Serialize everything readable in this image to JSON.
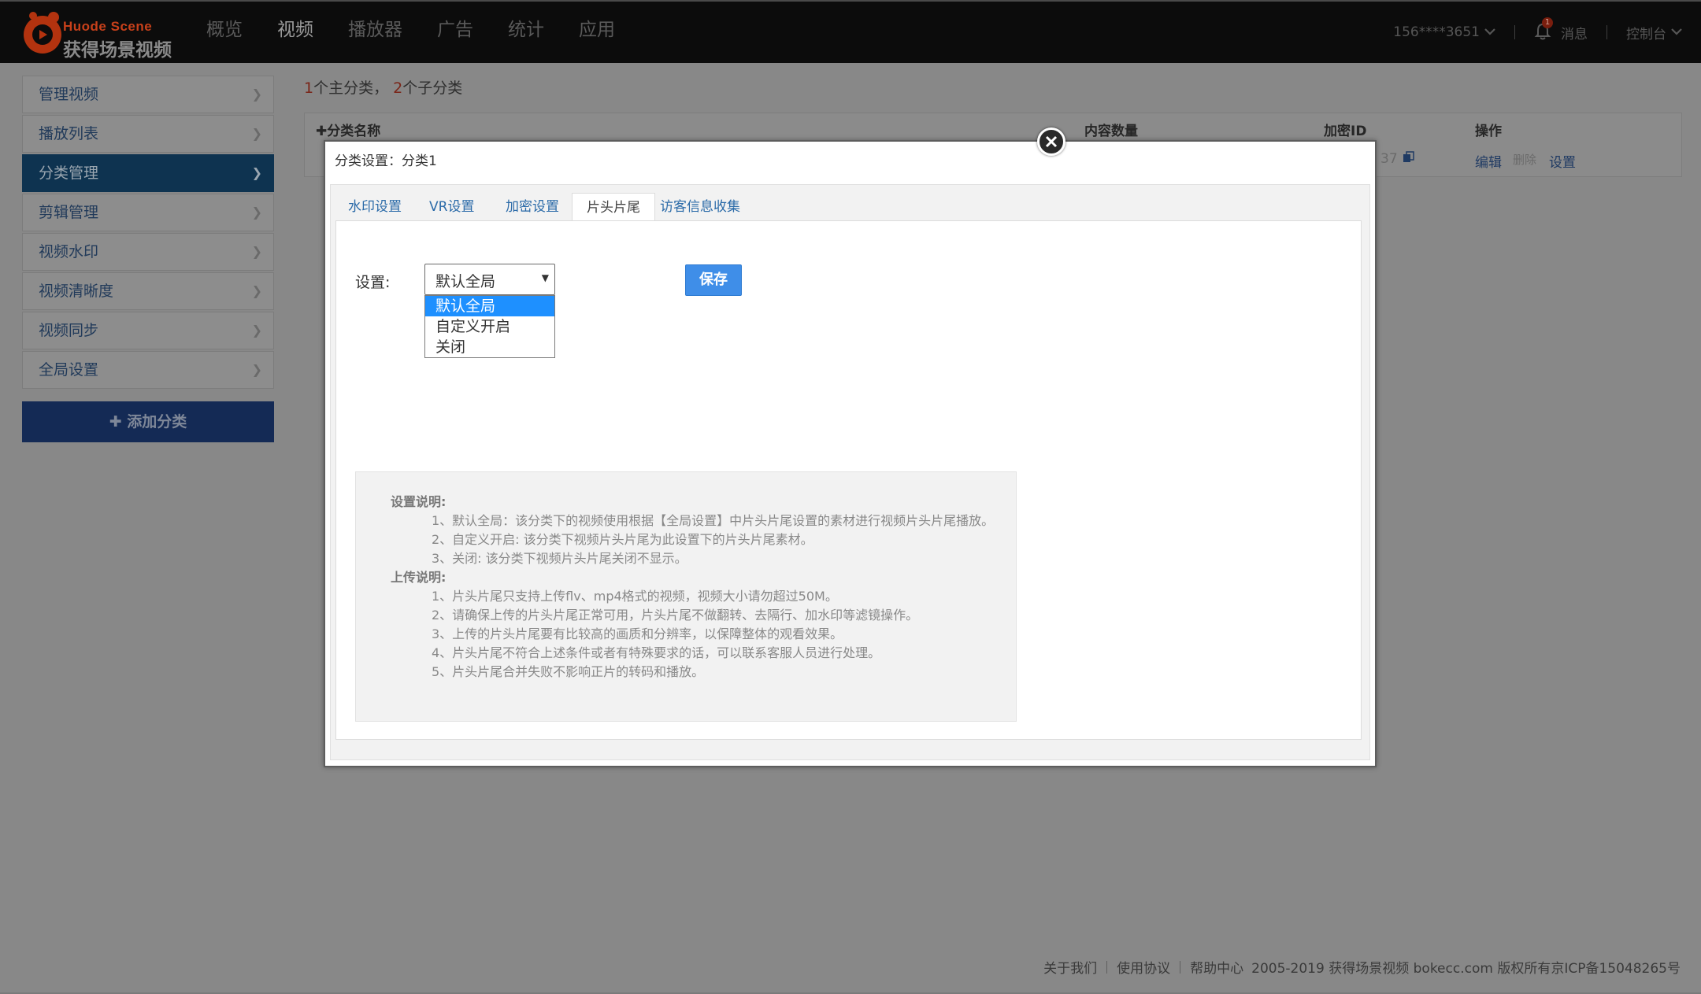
{
  "brand": {
    "name_en": "Huode Scene",
    "name_cn": "获得场景视频"
  },
  "nav": [
    {
      "label": "概览"
    },
    {
      "label": "视频"
    },
    {
      "label": "播放器"
    },
    {
      "label": "广告"
    },
    {
      "label": "统计"
    },
    {
      "label": "应用"
    }
  ],
  "user": {
    "account": "156****3651",
    "messages_label": "消息",
    "notification_count": "1",
    "console_label": "控制台"
  },
  "sidebar": {
    "items": [
      {
        "label": "管理视频"
      },
      {
        "label": "播放列表"
      },
      {
        "label": "分类管理"
      },
      {
        "label": "剪辑管理"
      },
      {
        "label": "视频水印"
      },
      {
        "label": "视频清晰度"
      },
      {
        "label": "视频同步"
      },
      {
        "label": "全局设置"
      }
    ],
    "add_button": "添加分类"
  },
  "summary": {
    "main_count": "1",
    "main_text": "个主分类，",
    "sub_count": "2",
    "sub_text": "个子分类"
  },
  "table": {
    "headers": {
      "name": "分类名称",
      "count": "内容数量",
      "id": "加密ID",
      "ops": "操作"
    },
    "row": {
      "id_fragment": "37",
      "edit": "编辑",
      "delete": "删除",
      "settings": "设置"
    }
  },
  "modal": {
    "title": "分类设置：分类1",
    "tabs": [
      {
        "label": "水印设置"
      },
      {
        "label": "VR设置"
      },
      {
        "label": "加密设置"
      },
      {
        "label": "片头片尾"
      },
      {
        "label": "访客信息收集"
      }
    ],
    "setting_label": "设置:",
    "select_value": "默认全局",
    "options": [
      "默认全局",
      "自定义开启",
      "关闭"
    ],
    "save_label": "保存",
    "notes": {
      "settings_title": "设置说明:",
      "settings": [
        "1、默认全局：该分类下的视频使用根据【全局设置】中片头片尾设置的素材进行视频片头片尾播放。",
        "2、自定义开启: 该分类下视频片头片尾为此设置下的片头片尾素材。",
        "3、关闭: 该分类下视频片头片尾关闭不显示。"
      ],
      "upload_title": "上传说明:",
      "upload": [
        "1、片头片尾只支持上传flv、mp4格式的视频，视频大小请勿超过50M。",
        "2、请确保上传的片头片尾正常可用，片头片尾不做翻转、去隔行、加水印等滤镜操作。",
        "3、上传的片头片尾要有比较高的画质和分辨率，以保障整体的观看效果。",
        "4、片头片尾不符合上述条件或者有特殊要求的话，可以联系客服人员进行处理。",
        "5、片头片尾合并失败不影响正片的转码和播放。"
      ]
    }
  },
  "footer": {
    "about": "关于我们",
    "terms": "使用协议",
    "help": "帮助中心",
    "copyright": "2005-2019 获得场景视频 bokecc.com 版权所有京ICP备15048265号"
  }
}
